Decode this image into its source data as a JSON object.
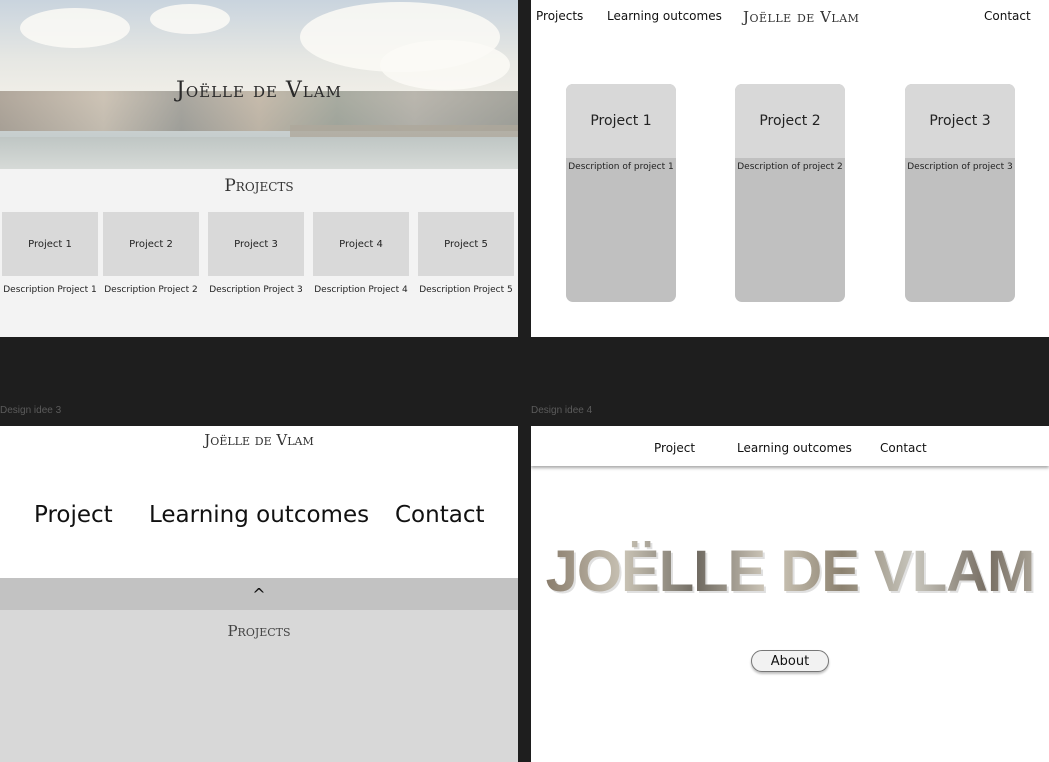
{
  "design1": {
    "hero_title": "Joëlle de Vlam",
    "section_title": "Projects",
    "projects": [
      {
        "label": "Project 1",
        "desc": "Description Project 1"
      },
      {
        "label": "Project 2",
        "desc": "Description Project 2"
      },
      {
        "label": "Project 3",
        "desc": "Description Project 3"
      },
      {
        "label": "Project 4",
        "desc": "Description Project 4"
      },
      {
        "label": "Project 5",
        "desc": "Description Project 5"
      }
    ]
  },
  "design2": {
    "nav": {
      "projects": "Projects",
      "learning": "Learning outcomes",
      "contact": "Contact"
    },
    "brand": "Joëlle de Vlam",
    "projects": [
      {
        "label": "Project 1",
        "desc": "Description of project 1"
      },
      {
        "label": "Project 2",
        "desc": "Description of project 2"
      },
      {
        "label": "Project 3",
        "desc": "Description of project 3"
      }
    ]
  },
  "design3": {
    "frame_label": "Design idee 3",
    "brand": "Joëlle de Vlam",
    "menu": {
      "project": "Project",
      "learning": "Learning outcomes",
      "contact": "Contact"
    },
    "caret": "^",
    "section_title": "Projects"
  },
  "design4": {
    "frame_label": "Design idee 4",
    "nav": {
      "project": "Project",
      "learning": "Learning outcomes",
      "contact": "Contact"
    },
    "big_title": "JOËLLE DE VLAM",
    "about_label": "About"
  }
}
